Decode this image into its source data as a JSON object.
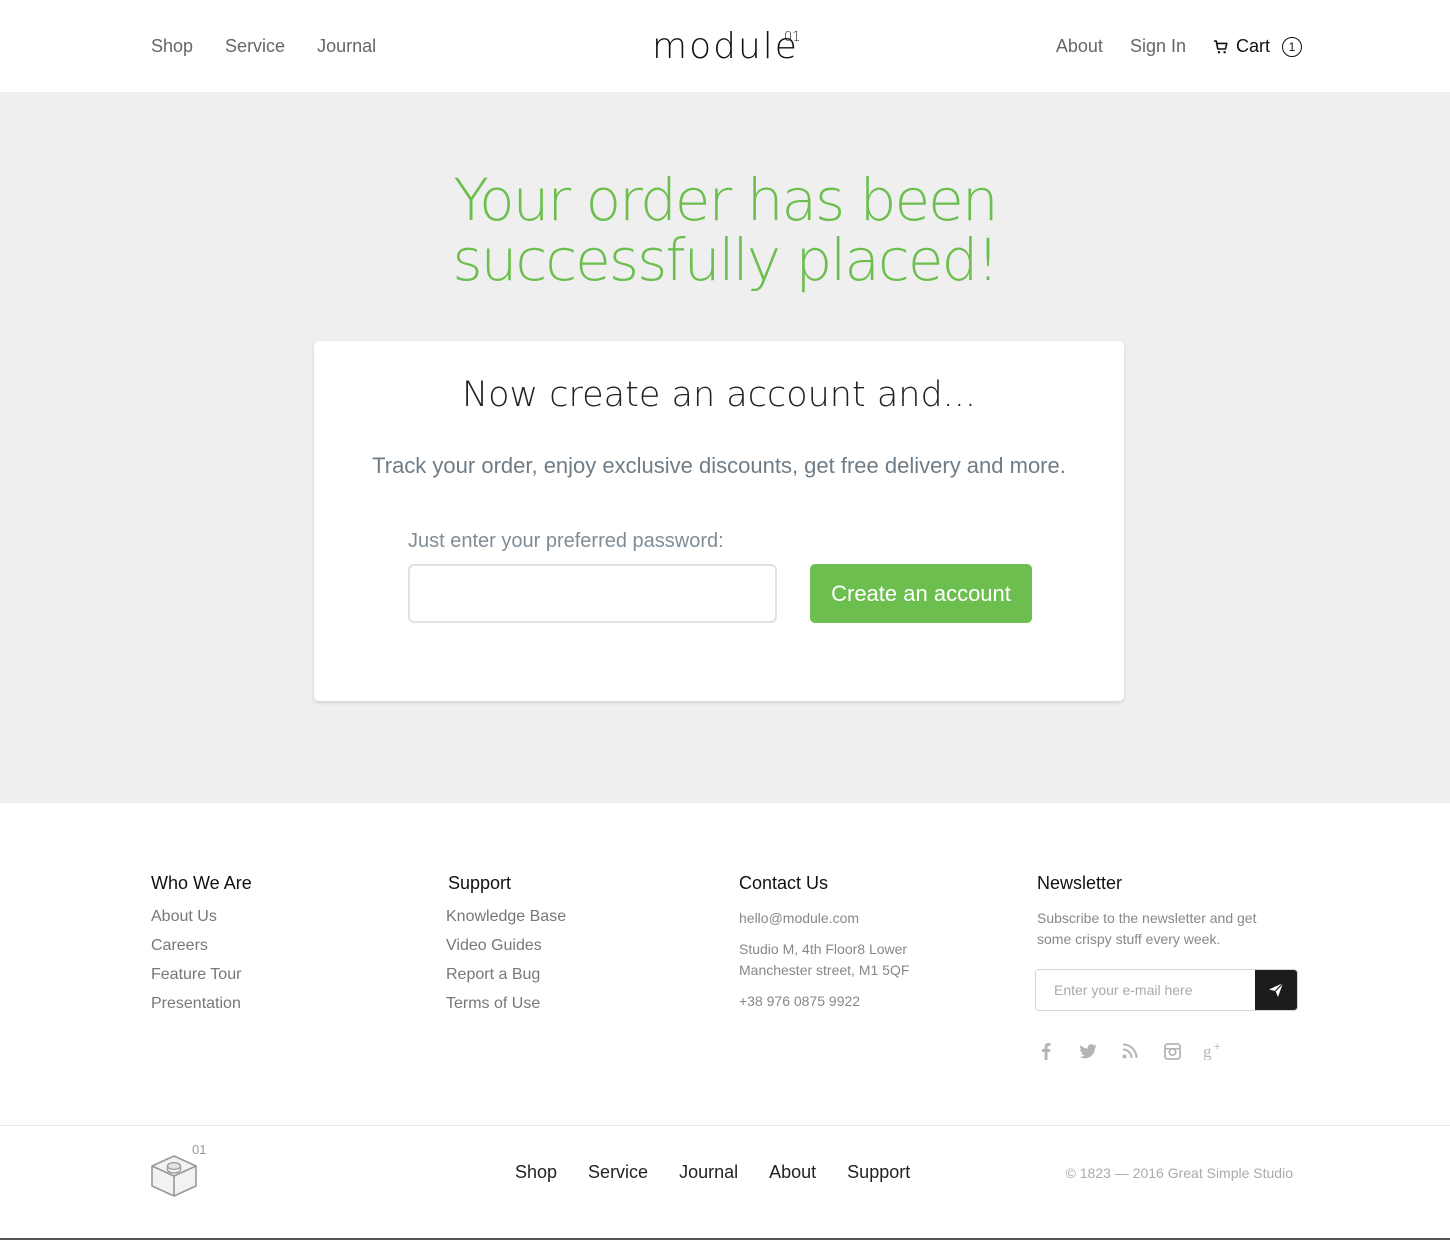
{
  "header": {
    "nav_left": [
      "Shop",
      "Service",
      "Journal"
    ],
    "logo": "module",
    "logo_sup": "01",
    "nav_right": [
      "About",
      "Sign In"
    ],
    "cart_label": "Cart",
    "cart_count": "1"
  },
  "hero": {
    "title_line1": "Your order has been",
    "title_line2": "successfully placed!",
    "card_title": "Now create an account and...",
    "card_subtitle": "Track your order, enjoy exclusive discounts, get free delivery and more.",
    "password_label": "Just enter your preferred password:",
    "password_value": "",
    "create_button": "Create an account"
  },
  "footer": {
    "who_we_are": {
      "heading": "Who We Are",
      "links": [
        "About Us",
        "Careers",
        "Feature Tour",
        "Presentation"
      ]
    },
    "support": {
      "heading": "Support",
      "links": [
        "Knowledge Base",
        "Video Guides",
        "Report a Bug",
        "Terms of Use"
      ]
    },
    "contact": {
      "heading": "Contact Us",
      "email": "hello@module.com",
      "address_line1": "Studio M, 4th Floor8 Lower",
      "address_line2": "Manchester street, M1 5QF",
      "phone": "+38 976 0875 9922"
    },
    "newsletter": {
      "heading": "Newsletter",
      "text_line1": "Subscribe to the newsletter and get",
      "text_line2": "some crispy stuff every week.",
      "placeholder": "Enter your e-mail here"
    },
    "social_icons": [
      "facebook-icon",
      "twitter-icon",
      "rss-icon",
      "instagram-icon",
      "google-plus-icon"
    ]
  },
  "bottom": {
    "logo_sup": "01",
    "nav": [
      "Shop",
      "Service",
      "Journal",
      "About",
      "Support"
    ],
    "copyright": "© 1823 — 2016 Great Simple Studio"
  },
  "colors": {
    "accent": "#6cbf4f",
    "hero_bg": "#efefef",
    "dark_button": "#1c1c1c"
  }
}
